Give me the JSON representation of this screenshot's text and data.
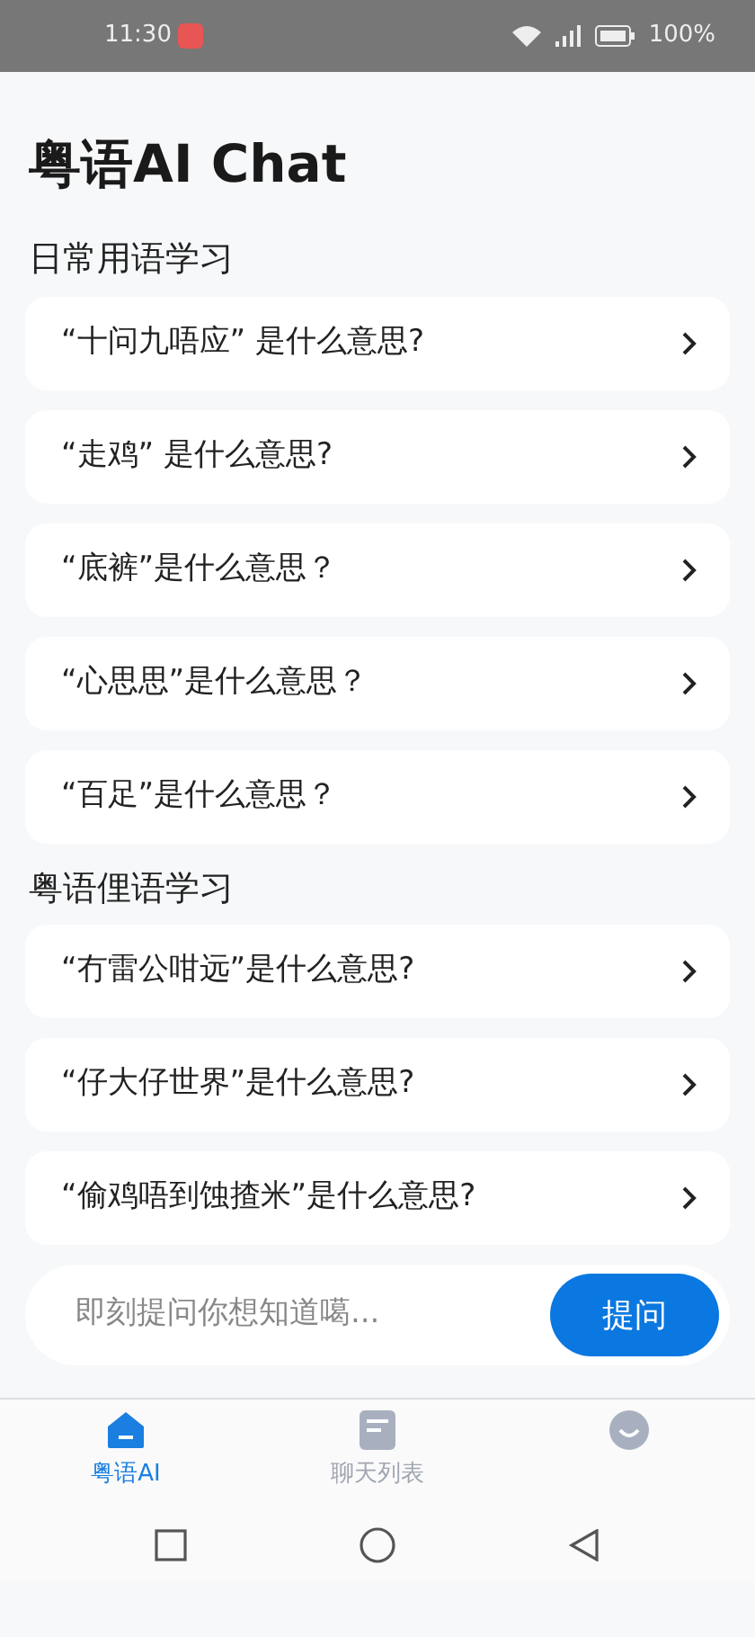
{
  "status_bar": {
    "time": "11:30",
    "battery": "100%"
  },
  "title": "粤语AI Chat",
  "sections": [
    {
      "heading": "日常用语学习",
      "items": [
        {
          "text": "“十问九唔应” 是什么意思?"
        },
        {
          "text": "“走鸡” 是什么意思?"
        },
        {
          "text": "“底裤”是什么意思？"
        },
        {
          "text": "“心思思”是什么意思？"
        },
        {
          "text": "“百足”是什么意思？"
        }
      ]
    },
    {
      "heading": "粤语俚语学习",
      "items": [
        {
          "text": "“冇雷公咁远”是什么意思?"
        },
        {
          "text": "“仔大仔世界”是什么意思?"
        },
        {
          "text": "“偷鸡唔到蚀揸米”是什么意思?"
        }
      ]
    }
  ],
  "ask": {
    "placeholder": "即刻提问你想知道噶...",
    "button": "提问"
  },
  "tabs": [
    {
      "kind": "home",
      "label": "粤语AI",
      "selected": true
    },
    {
      "kind": "list",
      "label": "聊天列表",
      "selected": false
    },
    {
      "kind": "face",
      "selected": false
    }
  ]
}
